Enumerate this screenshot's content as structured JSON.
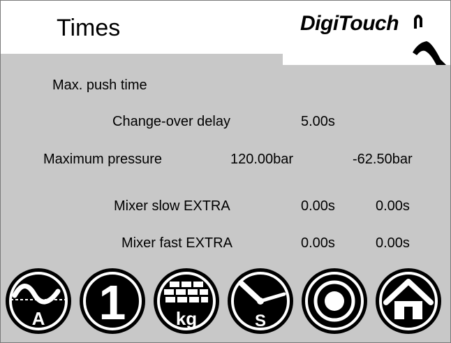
{
  "header": {
    "title": "Times",
    "logo_text": "DigiTouch"
  },
  "settings": {
    "max_push_time": {
      "label": "Max. push time"
    },
    "changeover_delay": {
      "label": "Change-over delay",
      "value": "5.00s"
    },
    "maximum_pressure": {
      "label": "Maximum pressure",
      "value1": "120.00bar",
      "value2": "-62.50bar"
    },
    "mixer_slow_extra": {
      "label": "Mixer slow EXTRA",
      "value1": "0.00s",
      "value2": "0.00s"
    },
    "mixer_fast_extra": {
      "label": "Mixer fast EXTRA",
      "value1": "0.00s",
      "value2": "0.00s"
    }
  },
  "toolbar": {
    "buttons": [
      {
        "icon": "sine-wave-a-icon",
        "glyph": "A"
      },
      {
        "icon": "number-one-icon",
        "glyph": "1"
      },
      {
        "icon": "bricks-kg-icon",
        "glyph": "kg"
      },
      {
        "icon": "clock-s-icon",
        "glyph": "S"
      },
      {
        "icon": "target-icon"
      },
      {
        "icon": "home-icon"
      }
    ]
  },
  "colors": {
    "background": "#c8c8c8",
    "button_fill": "#000000",
    "button_ring": "#ffffff"
  }
}
